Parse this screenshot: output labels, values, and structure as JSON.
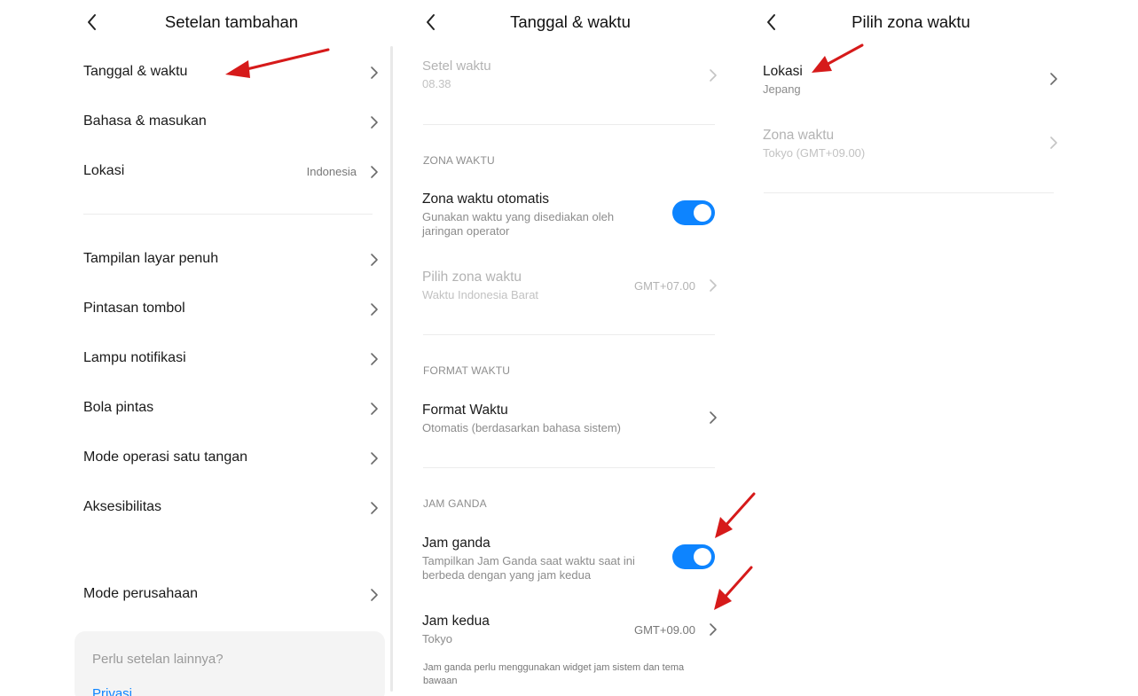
{
  "colors": {
    "accent": "#0d84ff",
    "arrow": "#d61a1a"
  },
  "icons": {
    "back": "chevron-left-icon",
    "chevron": "chevron-right-icon"
  },
  "panel1": {
    "title": "Setelan tambahan",
    "items": [
      {
        "label": "Tanggal & waktu"
      },
      {
        "label": "Bahasa & masukan"
      },
      {
        "label": "Lokasi",
        "value": "Indonesia"
      },
      {
        "label": "Tampilan layar penuh"
      },
      {
        "label": "Pintasan tombol"
      },
      {
        "label": "Lampu notifikasi"
      },
      {
        "label": "Bola pintas"
      },
      {
        "label": "Mode operasi satu tangan"
      },
      {
        "label": "Aksesibilitas"
      },
      {
        "label": "Mode perusahaan"
      }
    ],
    "more_card": {
      "title": "Perlu setelan lainnya?",
      "link": "Privasi"
    }
  },
  "panel2": {
    "title": "Tanggal & waktu",
    "set_time": {
      "label": "Setel waktu",
      "value": "08.38"
    },
    "section_zone": "ZONA WAKTU",
    "auto_zone": {
      "label": "Zona waktu otomatis",
      "sub": "Gunakan waktu yang disediakan oleh jaringan operator",
      "on": true
    },
    "pick_zone": {
      "label": "Pilih zona waktu",
      "sub": "Waktu Indonesia Barat",
      "value": "GMT+07.00"
    },
    "section_format": "FORMAT WAKTU",
    "time_format": {
      "label": "Format Waktu",
      "sub": "Otomatis (berdasarkan bahasa sistem)"
    },
    "section_dual": "JAM GANDA",
    "dual_clock": {
      "label": "Jam ganda",
      "sub": "Tampilkan Jam Ganda saat waktu saat ini berbeda dengan yang jam kedua",
      "on": true
    },
    "second_clock": {
      "label": "Jam kedua",
      "sub": "Tokyo",
      "value": "GMT+09.00"
    },
    "note": "Jam ganda perlu menggunakan widget jam sistem dan tema bawaan"
  },
  "panel3": {
    "title": "Pilih zona waktu",
    "location": {
      "label": "Lokasi",
      "sub": "Jepang"
    },
    "zone": {
      "label": "Zona waktu",
      "sub": "Tokyo (GMT+09.00)"
    }
  }
}
